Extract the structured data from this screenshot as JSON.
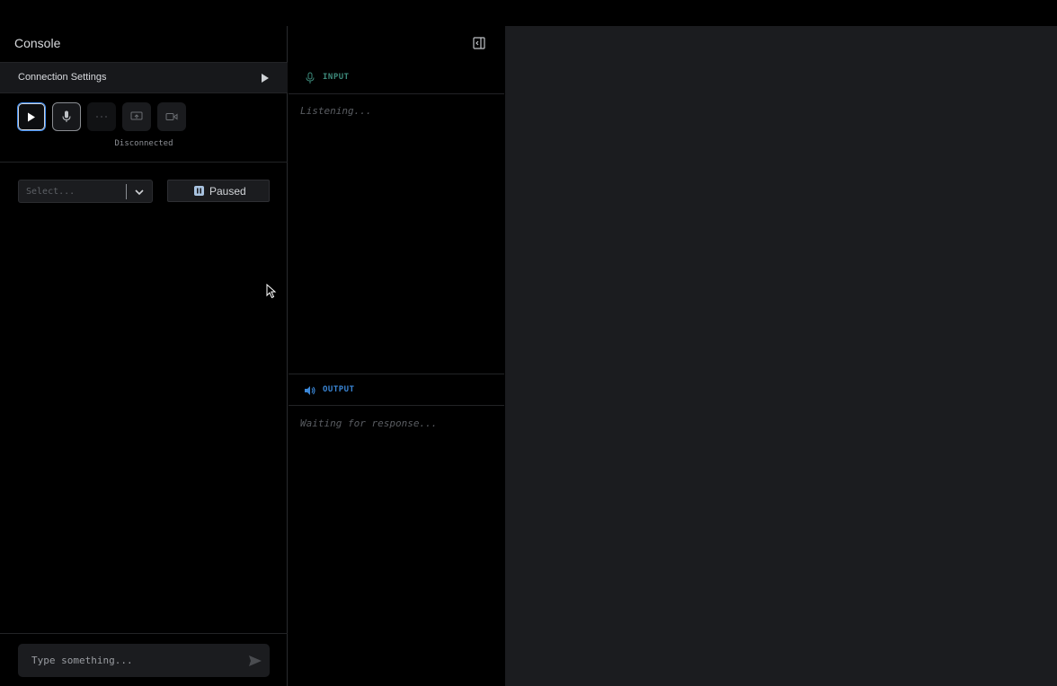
{
  "header": {
    "title": "Console"
  },
  "connection": {
    "label": "Connection Settings",
    "status": "Disconnected"
  },
  "controls": {
    "select_placeholder": "Select...",
    "paused_label": "Paused"
  },
  "chat": {
    "placeholder": "Type something..."
  },
  "input_panel": {
    "label": "INPUT",
    "body": "Listening..."
  },
  "output_panel": {
    "label": "OUTPUT",
    "body": "Waiting for response..."
  },
  "colors": {
    "accent_blue": "#3f8df2",
    "input_green": "#3d8a7b",
    "output_blue": "#3a86d6",
    "panel_bg": "#1b1c1f"
  },
  "icons": {
    "collapse": "sidebar-collapse-icon",
    "play": "play-icon",
    "mic": "microphone-icon",
    "dots": "more-dots-icon",
    "screen": "screen-share-icon",
    "camera": "video-camera-icon",
    "chevron": "chevron-down-icon",
    "pause": "pause-icon",
    "send": "send-icon",
    "speaker": "speaker-icon"
  }
}
